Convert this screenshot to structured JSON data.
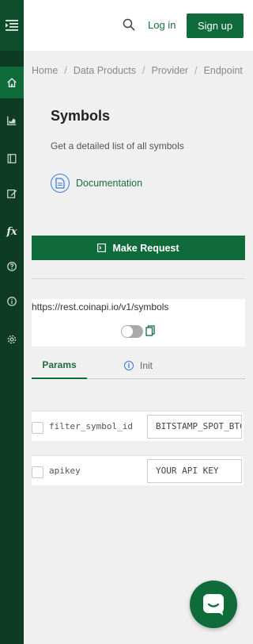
{
  "header": {
    "login_label": "Log in",
    "signup_label": "Sign up"
  },
  "breadcrumb": {
    "items": [
      "Home",
      "Data Products",
      "Provider",
      "Endpoint"
    ],
    "separator": "/"
  },
  "page": {
    "title": "Symbols",
    "subtitle": "Get a detailed list of all symbols",
    "documentation_label": "Documentation"
  },
  "request": {
    "button_label": "Make Request",
    "url": "https://rest.coinapi.io/v1/symbols"
  },
  "tabs": {
    "params_label": "Params",
    "init_label": "Init"
  },
  "params": [
    {
      "name": "filter_symbol_id",
      "value": "BITSTAMP_SPOT_BTC"
    },
    {
      "name": "apikey",
      "value": "YOUR API KEY"
    }
  ],
  "sidebar": {
    "fx_label": "fx",
    "icons": [
      "menu-icon",
      "home-icon",
      "chart-icon",
      "book-icon",
      "edit-icon",
      "fx-icon",
      "help-icon",
      "info-icon",
      "settings-icon"
    ]
  },
  "colors": {
    "brand_green": "#0f6b3a",
    "sidebar_dark": "#0d3b24",
    "link_blue": "#3a7bd5"
  }
}
